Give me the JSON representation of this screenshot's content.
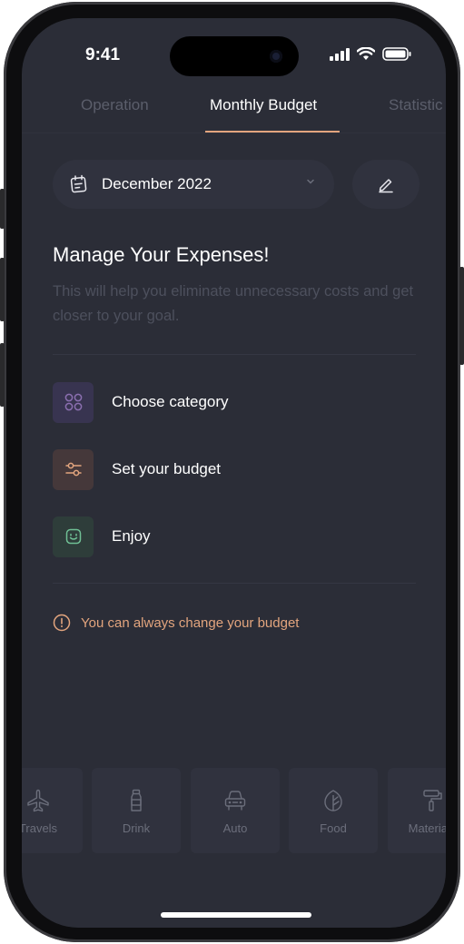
{
  "status_bar": {
    "time": "9:41"
  },
  "tabs": [
    {
      "label": "Operation",
      "active": false
    },
    {
      "label": "Monthly Budget",
      "active": true
    },
    {
      "label": "Statistic",
      "active": false
    }
  ],
  "month_selector": {
    "label": "December 2022"
  },
  "intro": {
    "title": "Manage Your Expenses!",
    "subtitle": "This will help you eliminate unnecessary costs and get closer to your goal."
  },
  "steps": [
    {
      "label": "Choose category",
      "icon": "category-grid-icon",
      "color": "#8b6fb0"
    },
    {
      "label": "Set your budget",
      "icon": "sliders-icon",
      "color": "#e3a57e"
    },
    {
      "label": "Enjoy",
      "icon": "smile-icon",
      "color": "#6fbf94"
    }
  ],
  "note": {
    "text": "You can always change your budget",
    "icon": "info-icon",
    "color": "#e3a57e"
  },
  "categories": [
    {
      "label": "Travels",
      "icon": "plane-icon"
    },
    {
      "label": "Drink",
      "icon": "bottle-icon"
    },
    {
      "label": "Auto",
      "icon": "car-icon"
    },
    {
      "label": "Food",
      "icon": "leaf-icon"
    },
    {
      "label": "Materials",
      "icon": "paint-roller-icon"
    }
  ],
  "colors": {
    "accent": "#e3a57e",
    "background": "#2b2d37",
    "surface": "#30323e"
  }
}
